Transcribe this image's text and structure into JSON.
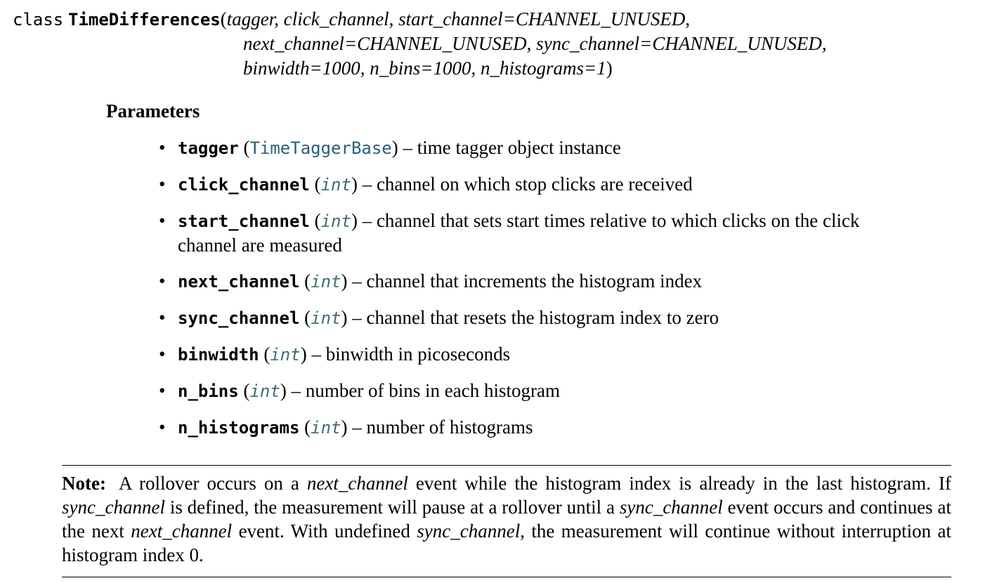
{
  "signature": {
    "keyword": "class",
    "class_name": "TimeDifferences",
    "open_paren": "(",
    "line1_args": "tagger, click_channel, start_channel=CHANNEL_UNUSED,",
    "line2_args": "next_channel=CHANNEL_UNUSED, sync_channel=CHANNEL_UNUSED,",
    "line3_args": "binwidth=1000, n_bins=1000, n_histograms=1",
    "close_paren": ")"
  },
  "parameters": {
    "title": "Parameters",
    "items": [
      {
        "name": "tagger",
        "type": "TimeTaggerBase",
        "description": "time tagger object instance"
      },
      {
        "name": "click_channel",
        "type": "int",
        "description": "channel on which stop clicks are received"
      },
      {
        "name": "start_channel",
        "type": "int",
        "description": "channel that sets start times relative to which clicks on the click channel are measured"
      },
      {
        "name": "next_channel",
        "type": "int",
        "description": "channel that increments the histogram index"
      },
      {
        "name": "sync_channel",
        "type": "int",
        "description": "channel that resets the histogram index to zero"
      },
      {
        "name": "binwidth",
        "type": "int",
        "description": "binwidth in picoseconds"
      },
      {
        "name": "n_bins",
        "type": "int",
        "description": "number of bins in each histogram"
      },
      {
        "name": "n_histograms",
        "type": "int",
        "description": "number of histograms"
      }
    ]
  },
  "note": {
    "label": "Note:",
    "t1": "A rollover occurs on a ",
    "e1": "next_channel",
    "t2": " event while the histogram index is already in the last histogram. If ",
    "e2": "sync_channel",
    "t3": " is defined, the measurement will pause at a rollover until a ",
    "e3": "sync_channel",
    "t4": " event occurs and continues at the next ",
    "e4": "next_channel",
    "t5": " event. With undefined ",
    "e5": "sync_channel",
    "t6": ", the measurement will continue without interruption at histogram index 0."
  }
}
